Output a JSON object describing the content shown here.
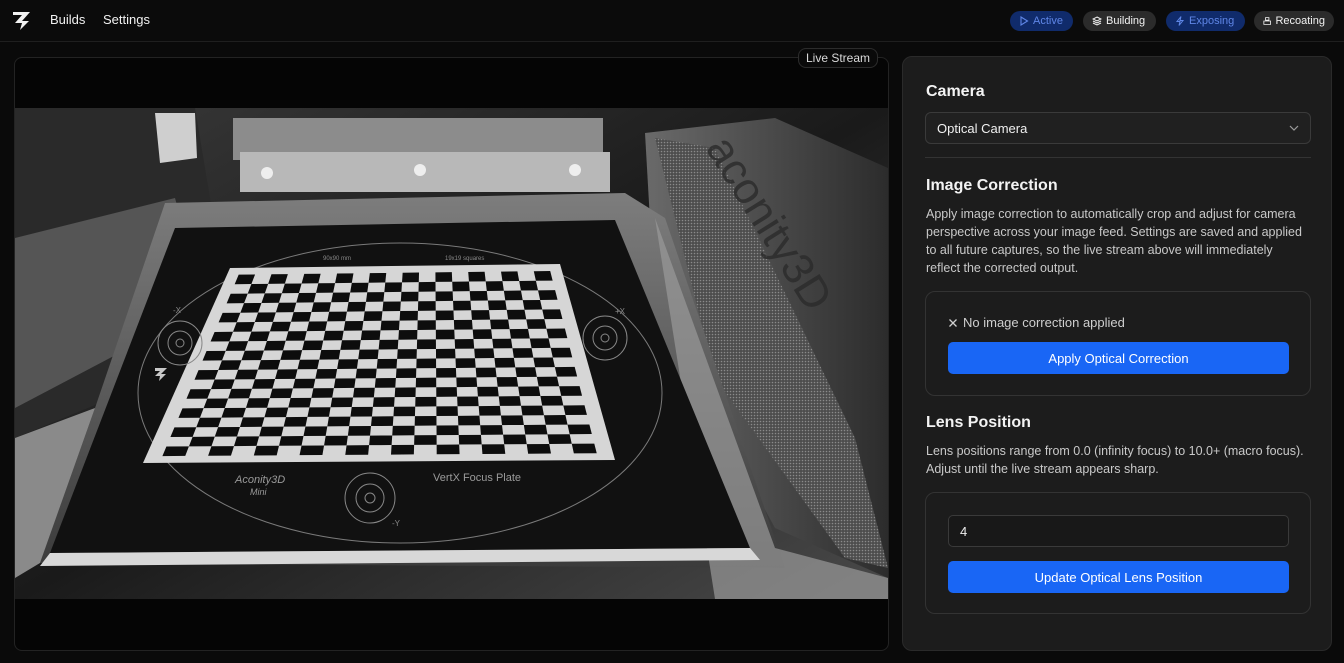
{
  "nav": {
    "builds": "Builds",
    "settings": "Settings"
  },
  "status": {
    "active": "Active",
    "building": "Building",
    "exposing": "Exposing",
    "recoating": "Recoating"
  },
  "stream": {
    "label": "Live Stream",
    "plate_texts": {
      "brand": "Aconity3D",
      "model": "Mini",
      "plate": "VertX Focus Plate",
      "size": "90x90 mm",
      "squares": "19x19 squares",
      "axis_x_pos": "+X",
      "axis_x_neg": "-X",
      "axis_y_neg": "-Y",
      "wall_brand": "aconity3D"
    }
  },
  "camera": {
    "heading": "Camera",
    "selected": "Optical Camera"
  },
  "image_correction": {
    "heading": "Image Correction",
    "description": "Apply image correction to automatically crop and adjust for camera perspective across your image feed. Settings are saved and applied to all future captures, so the live stream above will immediately reflect the corrected output.",
    "status": "No image correction applied",
    "button": "Apply Optical Correction"
  },
  "lens": {
    "heading": "Lens Position",
    "description": "Lens positions range from 0.0 (infinity focus) to 10.0+ (macro focus). Adjust until the live stream appears sharp.",
    "value": "4",
    "button": "Update Optical Lens Position"
  },
  "colors": {
    "accent": "#1966f5",
    "status_blue_bg": "#102b6b",
    "status_blue_text": "#5f86e6"
  }
}
